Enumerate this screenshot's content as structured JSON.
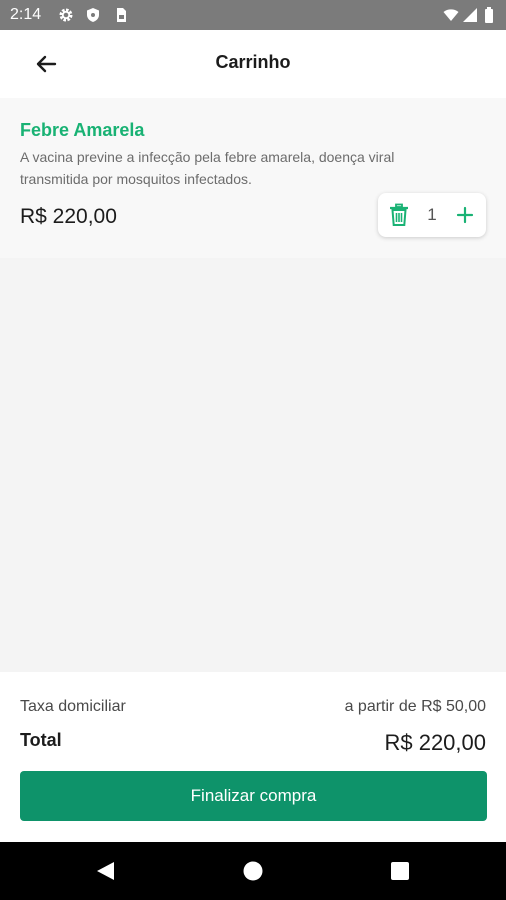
{
  "status_bar": {
    "time": "2:14",
    "icons_left": [
      "gear-icon",
      "shield-icon",
      "sim-card-icon"
    ],
    "icons_right": [
      "wifi-icon",
      "signal-icon",
      "battery-icon"
    ]
  },
  "header": {
    "title": "Carrinho",
    "back_icon": "arrow-left-icon"
  },
  "cart": {
    "items": [
      {
        "name": "Febre Amarela",
        "description": "A vacina previne a infecção pela febre amarela, doença viral transmitida por mosquitos infectados.",
        "price": "R$ 220,00",
        "quantity": "1"
      }
    ]
  },
  "summary": {
    "fee_label": "Taxa domiciliar",
    "fee_value": "a partir de R$ 50,00",
    "total_label": "Total",
    "total_value": "R$ 220,00",
    "checkout_label": "Finalizar compra"
  },
  "nav_bar": {
    "buttons": [
      "back-triangle-icon",
      "home-circle-icon",
      "recents-square-icon"
    ]
  },
  "colors": {
    "accent": "#19b274",
    "button": "#0e936a",
    "status_bar": "#7b7b7b"
  }
}
